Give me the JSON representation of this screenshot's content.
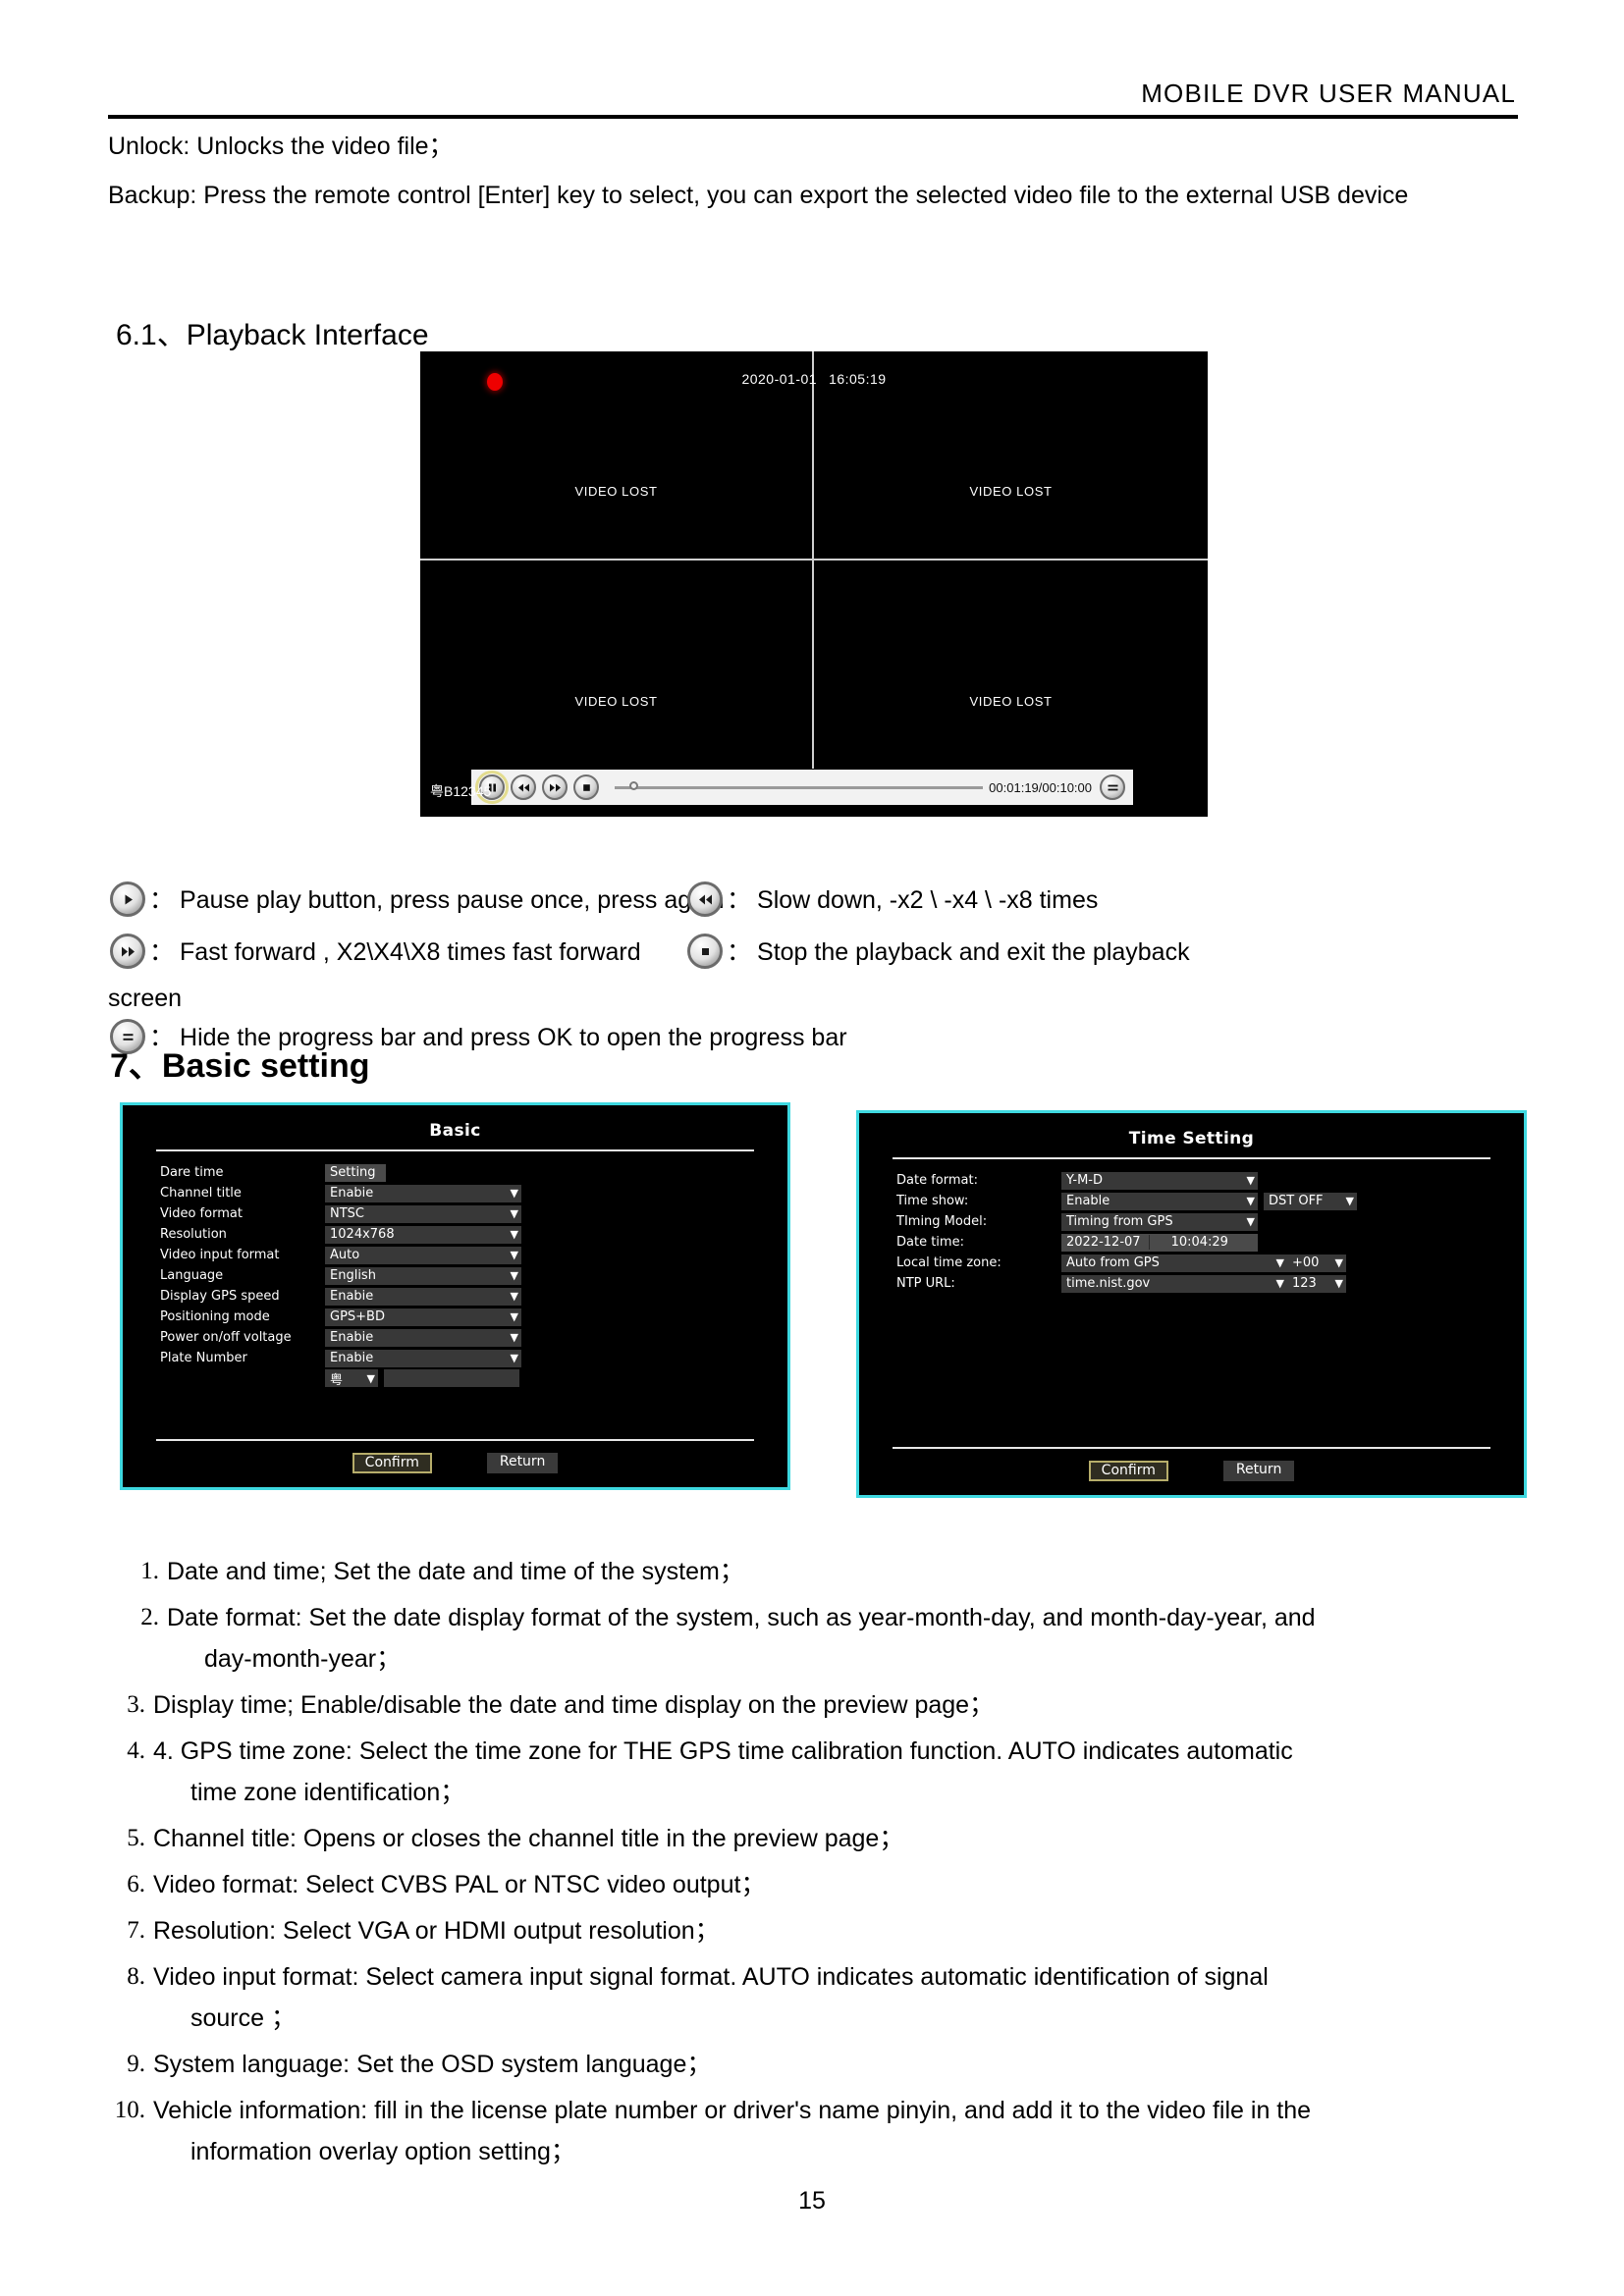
{
  "header": {
    "title": "MOBILE  DVR  USER  MANUAL"
  },
  "intro": {
    "unlock": "Unlock: Unlocks the video file；",
    "backup": "Backup: Press the remote control [Enter] key to select, you can export the selected video file to the external USB device"
  },
  "section_61": {
    "heading": "6.1、Playback Interface"
  },
  "playback": {
    "osd_date": "2020-01-01",
    "osd_time": "16:05:19",
    "quadrants": [
      {
        "label": "VIDEO LOST"
      },
      {
        "label": "VIDEO LOST"
      },
      {
        "label": "VIDEO LOST"
      },
      {
        "label": "VIDEO LOST"
      }
    ],
    "plate": "粤B12345",
    "progress_time": "00:01:19/00:10:00",
    "progress_percent": 4,
    "buttons": [
      {
        "name": "pause",
        "selected": true
      },
      {
        "name": "rewind",
        "selected": false
      },
      {
        "name": "fast-forward",
        "selected": false
      },
      {
        "name": "stop",
        "selected": false
      }
    ],
    "menu_button": "hide-progress-bar"
  },
  "legend": [
    {
      "icon": "play-icon",
      "colon": "：",
      "text": "Pause play button, press pause once, press again"
    },
    {
      "icon": "rewind-icon",
      "colon": "：",
      "text": "Slow down, -x2 \\ -x4 \\ -x8 times"
    },
    {
      "icon": "fast-forward-icon",
      "colon": "：",
      "text": "Fast forward , X2\\X4\\X8 times fast forward"
    },
    {
      "icon": "stop-icon",
      "colon": "：",
      "text": "Stop the playback    and exit the playback"
    },
    {
      "icon": "menu-icon",
      "colon": "：",
      "text": "Hide the progress bar    and press OK to open the progress bar"
    }
  ],
  "legend_continuation": "screen",
  "section_7": {
    "heading": "7、Basic setting"
  },
  "basic_panel": {
    "title": "Basic",
    "rows": [
      {
        "label": "Dare time",
        "value": "Setting",
        "type": "plain"
      },
      {
        "label": "Channel title",
        "value": "Enabie",
        "type": "select"
      },
      {
        "label": "Video format",
        "value": "NTSC",
        "type": "select"
      },
      {
        "label": "Resolution",
        "value": "1024x768",
        "type": "select"
      },
      {
        "label": "Video input format",
        "value": "Auto",
        "type": "select"
      },
      {
        "label": "Language",
        "value": "English",
        "type": "select"
      },
      {
        "label": "Display GPS speed",
        "value": "Enabie",
        "type": "select"
      },
      {
        "label": "Positioning mode",
        "value": "GPS+BD",
        "type": "select"
      },
      {
        "label": "Power on/off voltage",
        "value": "Enabie",
        "type": "select"
      },
      {
        "label": "Plate Number",
        "value": "Enabie",
        "type": "select"
      }
    ],
    "plate_prefix": "粤",
    "plate_value": "",
    "confirm": "Confirm",
    "return": "Return"
  },
  "time_panel": {
    "title": "Time  Setting",
    "rows": [
      {
        "label": "Date format:",
        "value": "Y-M-D"
      },
      {
        "label": "Time show:",
        "value": "Enable",
        "extra": "DST OFF"
      },
      {
        "label": "TIming Model:",
        "value": "Timing from GPS"
      },
      {
        "label": "Local time zone:",
        "value": "Auto from GPS",
        "extra": "+00"
      },
      {
        "label": "NTP URL:",
        "value": "time.nist.gov",
        "extra": "123"
      }
    ],
    "datetime_label": "Date time:",
    "datetime_date": "2022-12-07",
    "datetime_time": "10:04:29",
    "confirm": "Confirm",
    "return": "Return"
  },
  "numbered_list": [
    {
      "marker": "1.",
      "text": "Date and time; Set the date and time of the system；",
      "cont": ""
    },
    {
      "marker": "2.",
      "text": "Date format: Set the date display format of the system, such as year-month-day, and month-day-year, and",
      "cont": "day-month-year；"
    },
    {
      "marker": "3.",
      "text": "Display time; Enable/disable the date and time display on the preview page；",
      "cont": ""
    },
    {
      "marker": "4.",
      "text": "4. GPS time zone: Select the time zone for THE GPS time calibration function. AUTO indicates automatic",
      "cont": "time zone identification；"
    },
    {
      "marker": "5.",
      "text": "Channel title: Opens or closes the channel title in the preview page；",
      "cont": ""
    },
    {
      "marker": "6.",
      "text": "Video format: Select CVBS PAL or NTSC video output；",
      "cont": ""
    },
    {
      "marker": "7.",
      "text": "Resolution: Select VGA or HDMI output resolution；",
      "cont": ""
    },
    {
      "marker": "8.",
      "text": "Video input format: Select camera input signal format. AUTO indicates automatic identification of signal",
      "cont": "source   ；"
    },
    {
      "marker": "9.",
      "text": "System language: Set the OSD system language；",
      "cont": ""
    },
    {
      "marker": "10.",
      "text": "Vehicle information: fill in the license plate number or driver's name pinyin, and add it to the video file in the",
      "cont": "information overlay option setting；"
    }
  ],
  "footer": {
    "page_number": "15"
  }
}
